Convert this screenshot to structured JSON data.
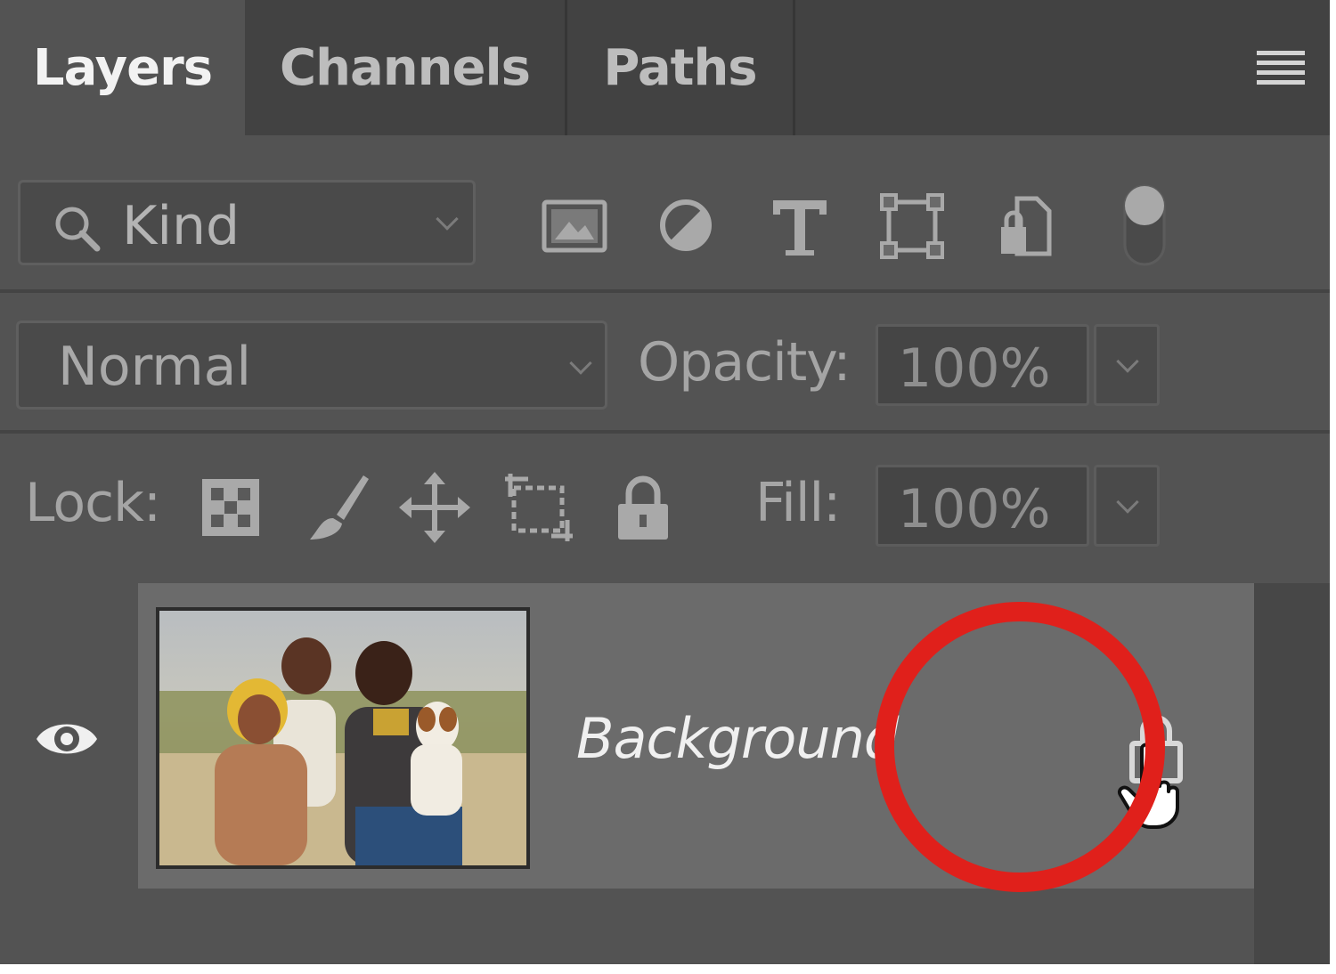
{
  "tabs": [
    {
      "label": "Layers",
      "active": true
    },
    {
      "label": "Channels",
      "active": false
    },
    {
      "label": "Paths",
      "active": false
    }
  ],
  "filter": {
    "kind_label": "Kind",
    "icons": [
      "image-filter-icon",
      "adjustment-filter-icon",
      "type-filter-icon",
      "shape-filter-icon",
      "smart-object-filter-icon",
      "filter-toggle-icon"
    ]
  },
  "blend": {
    "mode": "Normal",
    "opacity_label": "Opacity:",
    "opacity_value": "100%"
  },
  "lock": {
    "label": "Lock:",
    "icons": [
      "lock-transparent-pixels-icon",
      "lock-image-pixels-icon",
      "lock-position-icon",
      "lock-artboard-icon",
      "lock-all-icon"
    ],
    "fill_label": "Fill:",
    "fill_value": "100%"
  },
  "layers": [
    {
      "name": "Background",
      "visible": true,
      "locked": true
    }
  ],
  "colors": {
    "panel_bg": "#535353",
    "tabbar_bg": "#424242",
    "selected_row": "#6b6b6b",
    "highlight_circle": "#e0201b"
  }
}
